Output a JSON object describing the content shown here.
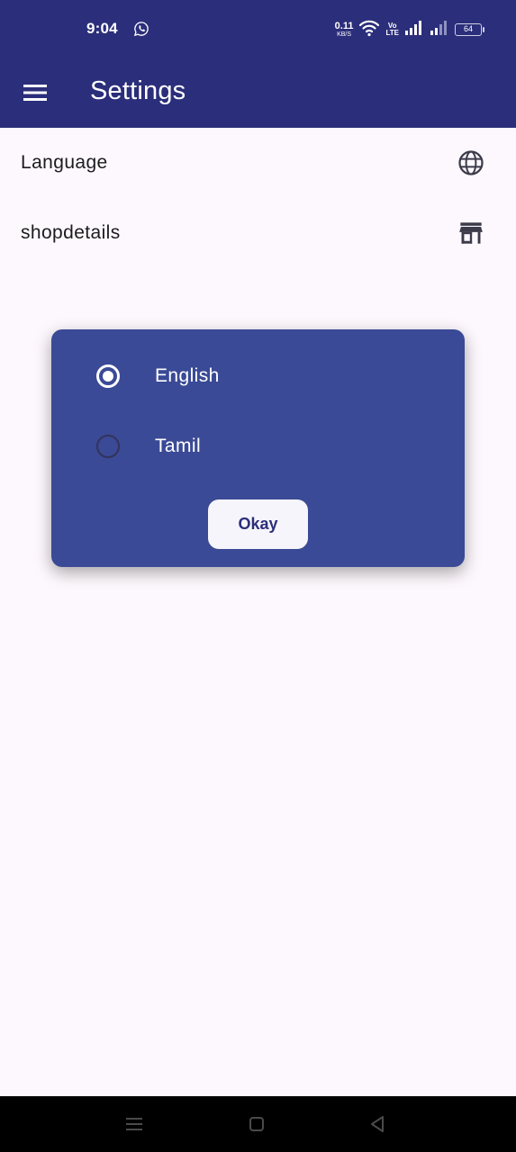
{
  "status_bar": {
    "time": "9:04",
    "net_speed_value": "0.11",
    "net_speed_unit": "KB/S",
    "volte_top": "Vo",
    "volte_bottom": "LTE",
    "battery": "64",
    "icons": [
      "whatsapp-icon",
      "wifi-icon",
      "signal-icon",
      "signal-icon-2"
    ]
  },
  "app_bar": {
    "title": "Settings",
    "menu_icon": "menu-icon"
  },
  "settings": {
    "items": [
      {
        "label": "Language",
        "icon": "globe-icon"
      },
      {
        "label": "shopdetails",
        "icon": "store-icon"
      }
    ]
  },
  "dialog": {
    "options": [
      {
        "label": "English",
        "selected": true
      },
      {
        "label": "Tamil",
        "selected": false
      }
    ],
    "okay_label": "Okay"
  },
  "nav_bar": {
    "icons": [
      "recents-icon",
      "home-icon",
      "back-icon"
    ]
  },
  "colors": {
    "primary": "#2b2e7a",
    "dialog_bg": "#3a4a96",
    "background": "#fdf8fd",
    "button_bg": "#f6f5fb"
  }
}
